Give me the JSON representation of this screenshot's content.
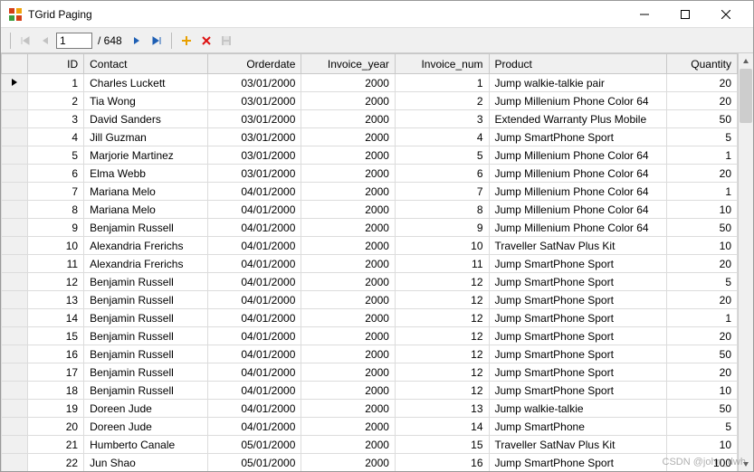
{
  "window": {
    "title": "TGrid Paging"
  },
  "pager": {
    "current": "1",
    "total_label": "/ 648"
  },
  "headers": {
    "id": "ID",
    "contact": "Contact",
    "orderdate": "Orderdate",
    "invoice_year": "Invoice_year",
    "invoice_num": "Invoice_num",
    "product": "Product",
    "quantity": "Quantity"
  },
  "rows": [
    {
      "id": 1,
      "contact": "Charles Luckett",
      "orderdate": "03/01/2000",
      "invoice_year": 2000,
      "invoice_num": 1,
      "product": "Jump walkie-talkie pair",
      "quantity": 20
    },
    {
      "id": 2,
      "contact": "Tia Wong",
      "orderdate": "03/01/2000",
      "invoice_year": 2000,
      "invoice_num": 2,
      "product": "Jump Millenium Phone Color 64",
      "quantity": 20
    },
    {
      "id": 3,
      "contact": "David Sanders",
      "orderdate": "03/01/2000",
      "invoice_year": 2000,
      "invoice_num": 3,
      "product": "Extended Warranty Plus Mobile",
      "quantity": 50
    },
    {
      "id": 4,
      "contact": "Jill Guzman",
      "orderdate": "03/01/2000",
      "invoice_year": 2000,
      "invoice_num": 4,
      "product": "Jump SmartPhone Sport",
      "quantity": 5
    },
    {
      "id": 5,
      "contact": "Marjorie Martinez",
      "orderdate": "03/01/2000",
      "invoice_year": 2000,
      "invoice_num": 5,
      "product": "Jump Millenium Phone Color 64",
      "quantity": 1
    },
    {
      "id": 6,
      "contact": "Elma Webb",
      "orderdate": "03/01/2000",
      "invoice_year": 2000,
      "invoice_num": 6,
      "product": "Jump Millenium Phone Color 64",
      "quantity": 20
    },
    {
      "id": 7,
      "contact": "Mariana Melo",
      "orderdate": "04/01/2000",
      "invoice_year": 2000,
      "invoice_num": 7,
      "product": "Jump Millenium Phone Color 64",
      "quantity": 1
    },
    {
      "id": 8,
      "contact": "Mariana Melo",
      "orderdate": "04/01/2000",
      "invoice_year": 2000,
      "invoice_num": 8,
      "product": "Jump Millenium Phone Color 64",
      "quantity": 10
    },
    {
      "id": 9,
      "contact": "Benjamin Russell",
      "orderdate": "04/01/2000",
      "invoice_year": 2000,
      "invoice_num": 9,
      "product": "Jump Millenium Phone Color 64",
      "quantity": 50
    },
    {
      "id": 10,
      "contact": "Alexandria Frerichs",
      "orderdate": "04/01/2000",
      "invoice_year": 2000,
      "invoice_num": 10,
      "product": "Traveller SatNav Plus Kit",
      "quantity": 10
    },
    {
      "id": 11,
      "contact": "Alexandria Frerichs",
      "orderdate": "04/01/2000",
      "invoice_year": 2000,
      "invoice_num": 11,
      "product": "Jump SmartPhone Sport",
      "quantity": 20
    },
    {
      "id": 12,
      "contact": "Benjamin Russell",
      "orderdate": "04/01/2000",
      "invoice_year": 2000,
      "invoice_num": 12,
      "product": "Jump SmartPhone Sport",
      "quantity": 5
    },
    {
      "id": 13,
      "contact": "Benjamin Russell",
      "orderdate": "04/01/2000",
      "invoice_year": 2000,
      "invoice_num": 12,
      "product": "Jump SmartPhone Sport",
      "quantity": 20
    },
    {
      "id": 14,
      "contact": "Benjamin Russell",
      "orderdate": "04/01/2000",
      "invoice_year": 2000,
      "invoice_num": 12,
      "product": "Jump SmartPhone Sport",
      "quantity": 1
    },
    {
      "id": 15,
      "contact": "Benjamin Russell",
      "orderdate": "04/01/2000",
      "invoice_year": 2000,
      "invoice_num": 12,
      "product": "Jump SmartPhone Sport",
      "quantity": 20
    },
    {
      "id": 16,
      "contact": "Benjamin Russell",
      "orderdate": "04/01/2000",
      "invoice_year": 2000,
      "invoice_num": 12,
      "product": "Jump SmartPhone Sport",
      "quantity": 50
    },
    {
      "id": 17,
      "contact": "Benjamin Russell",
      "orderdate": "04/01/2000",
      "invoice_year": 2000,
      "invoice_num": 12,
      "product": "Jump SmartPhone Sport",
      "quantity": 20
    },
    {
      "id": 18,
      "contact": "Benjamin Russell",
      "orderdate": "04/01/2000",
      "invoice_year": 2000,
      "invoice_num": 12,
      "product": "Jump SmartPhone Sport",
      "quantity": 10
    },
    {
      "id": 19,
      "contact": "Doreen Jude",
      "orderdate": "04/01/2000",
      "invoice_year": 2000,
      "invoice_num": 13,
      "product": "Jump walkie-talkie",
      "quantity": 50
    },
    {
      "id": 20,
      "contact": "Doreen Jude",
      "orderdate": "04/01/2000",
      "invoice_year": 2000,
      "invoice_num": 14,
      "product": "Jump SmartPhone",
      "quantity": 5
    },
    {
      "id": 21,
      "contact": "Humberto Canale",
      "orderdate": "05/01/2000",
      "invoice_year": 2000,
      "invoice_num": 15,
      "product": "Traveller SatNav Plus Kit",
      "quantity": 10
    },
    {
      "id": 22,
      "contact": "Jun Shao",
      "orderdate": "05/01/2000",
      "invoice_year": 2000,
      "invoice_num": 16,
      "product": "Jump SmartPhone Sport",
      "quantity": 100
    }
  ],
  "watermark": "CSDN @john_dwh"
}
